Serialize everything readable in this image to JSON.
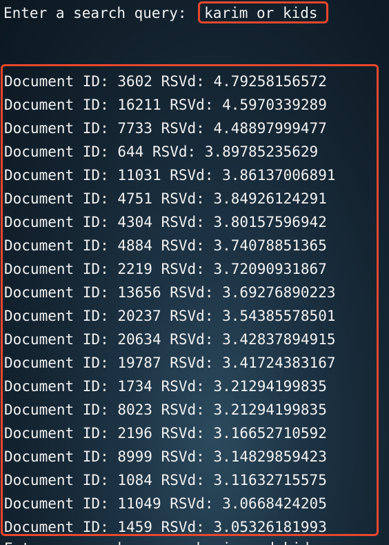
{
  "prompt": {
    "label": "Enter a search query: ",
    "query": "karim or kids"
  },
  "results": [
    {
      "id_label": "Document ID:",
      "id": "3602",
      "score_label": "RSVd:",
      "score": "4.79258156572"
    },
    {
      "id_label": "Document ID:",
      "id": "16211",
      "score_label": "RSVd:",
      "score": "4.5970339289"
    },
    {
      "id_label": "Document ID:",
      "id": "7733",
      "score_label": "RSVd:",
      "score": "4.48897999477"
    },
    {
      "id_label": "Document ID:",
      "id": "644",
      "score_label": "RSVd:",
      "score": "3.89785235629"
    },
    {
      "id_label": "Document ID:",
      "id": "11031",
      "score_label": "RSVd:",
      "score": "3.86137006891"
    },
    {
      "id_label": "Document ID:",
      "id": "4751",
      "score_label": "RSVd:",
      "score": "3.84926124291"
    },
    {
      "id_label": "Document ID:",
      "id": "4304",
      "score_label": "RSVd:",
      "score": "3.80157596942"
    },
    {
      "id_label": "Document ID:",
      "id": "4884",
      "score_label": "RSVd:",
      "score": "3.74078851365"
    },
    {
      "id_label": "Document ID:",
      "id": "2219",
      "score_label": "RSVd:",
      "score": "3.72090931867"
    },
    {
      "id_label": "Document ID:",
      "id": "13656",
      "score_label": "RSVd:",
      "score": "3.69276890223"
    },
    {
      "id_label": "Document ID:",
      "id": "20237",
      "score_label": "RSVd:",
      "score": "3.54385578501"
    },
    {
      "id_label": "Document ID:",
      "id": "20634",
      "score_label": "RSVd:",
      "score": "3.42837894915"
    },
    {
      "id_label": "Document ID:",
      "id": "19787",
      "score_label": "RSVd:",
      "score": "3.41724383167"
    },
    {
      "id_label": "Document ID:",
      "id": "1734",
      "score_label": "RSVd:",
      "score": "3.21294199835"
    },
    {
      "id_label": "Document ID:",
      "id": "8023",
      "score_label": "RSVd:",
      "score": "3.21294199835"
    },
    {
      "id_label": "Document ID:",
      "id": "2196",
      "score_label": "RSVd:",
      "score": "3.16652710592"
    },
    {
      "id_label": "Document ID:",
      "id": "8999",
      "score_label": "RSVd:",
      "score": "3.14829859423"
    },
    {
      "id_label": "Document ID:",
      "id": "1084",
      "score_label": "RSVd:",
      "score": "3.11632715575"
    },
    {
      "id_label": "Document ID:",
      "id": "11049",
      "score_label": "RSVd:",
      "score": "3.0668424205"
    },
    {
      "id_label": "Document ID:",
      "id": "1459",
      "score_label": "RSVd:",
      "score": "3.05326181993"
    }
  ],
  "next_prompt_partial": "Enter a search query: karim and kids",
  "colors": {
    "highlight": "#e8472e",
    "text": "#f2f2f2"
  }
}
